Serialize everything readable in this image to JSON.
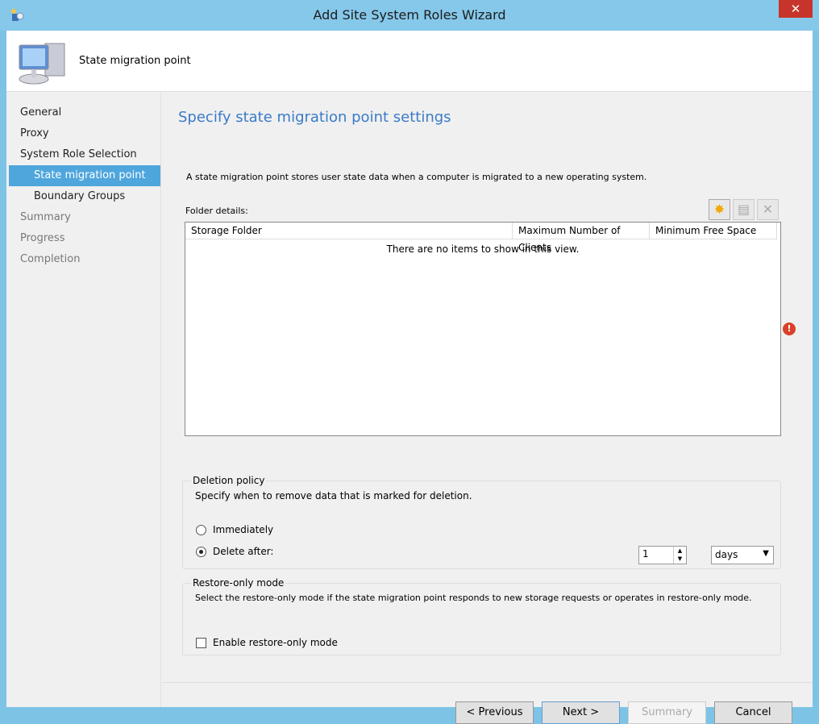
{
  "window": {
    "title": "Add Site System Roles Wizard",
    "close": "✕"
  },
  "header": {
    "label": "State migration point"
  },
  "nav": [
    {
      "label": "General",
      "state": "normal"
    },
    {
      "label": "Proxy",
      "state": "normal"
    },
    {
      "label": "System Role Selection",
      "state": "normal"
    },
    {
      "label": "State migration point",
      "state": "selected"
    },
    {
      "label": "Boundary Groups",
      "state": "normal"
    },
    {
      "label": "Summary",
      "state": "disabled"
    },
    {
      "label": "Progress",
      "state": "disabled"
    },
    {
      "label": "Completion",
      "state": "disabled"
    }
  ],
  "main": {
    "title": "Specify state migration point settings",
    "description": "A state migration point stores user state data when a computer is migrated to a new operating system.",
    "folder_label": "Folder details:",
    "columns": [
      "Storage Folder",
      "Maximum Number of Clients",
      "Minimum Free Space"
    ],
    "empty_text": "There are no items to show in this view.",
    "deletion": {
      "title": "Deletion policy",
      "desc": "Specify when to remove data that is marked for deletion.",
      "immediately": "Immediately",
      "delete_after": "Delete after:",
      "value": "1",
      "unit": "days",
      "selected": "delete_after"
    },
    "restore": {
      "title": "Restore-only mode",
      "desc": "Select the restore-only mode if the state migration point responds to new storage requests or operates in restore-only mode.",
      "checkbox": "Enable restore-only mode",
      "checked": false
    }
  },
  "buttons": {
    "previous": "< Previous",
    "next": "Next >",
    "summary": "Summary",
    "cancel": "Cancel"
  },
  "colors": {
    "accent": "#4ea6dc",
    "title": "#3a7bc8",
    "frame": "#7dc3e6",
    "error": "#d9412b"
  }
}
